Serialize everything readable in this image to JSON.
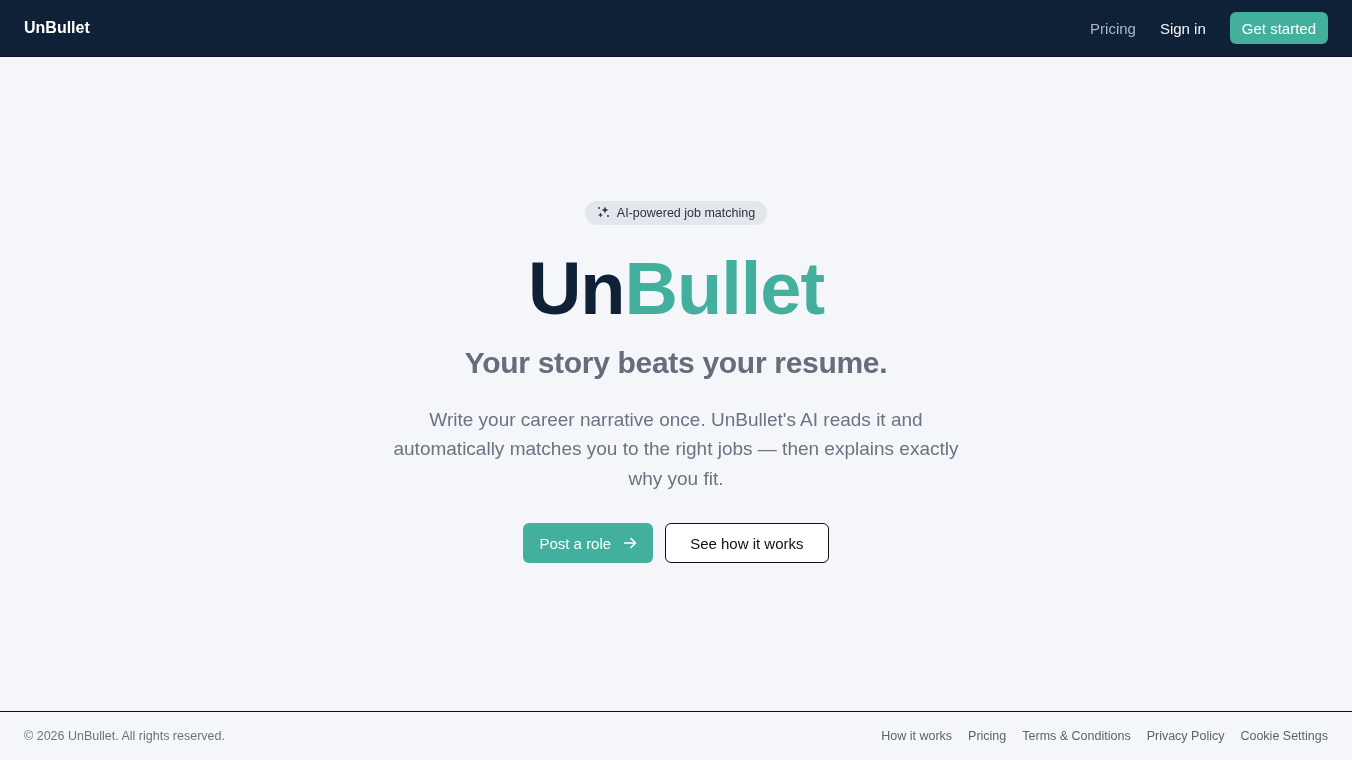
{
  "header": {
    "brand": "UnBullet",
    "nav": [
      {
        "label": "Pricing",
        "kind": "link"
      },
      {
        "label": "Sign in",
        "kind": "action"
      },
      {
        "label": "Get started",
        "kind": "primary"
      }
    ]
  },
  "hero": {
    "badge": "AI-powered job matching",
    "title": [
      {
        "text": "Un",
        "kind": "plain"
      },
      {
        "text": "Bullet",
        "kind": "accent"
      }
    ],
    "subtitle": "Your story beats your resume.",
    "description": "Write your career narrative once. UnBullet's AI reads it and automatically matches you to the right jobs — then explains exactly why you fit.",
    "buttons": [
      {
        "label": "Post a role",
        "kind": "primary"
      },
      {
        "label": "See how it works",
        "kind": "outline"
      }
    ]
  },
  "footer": {
    "copyright": "© 2026 UnBullet. All rights reserved.",
    "links": [
      "How it works",
      "Pricing",
      "Terms & Conditions",
      "Privacy Policy",
      "Cookie Settings"
    ]
  }
}
